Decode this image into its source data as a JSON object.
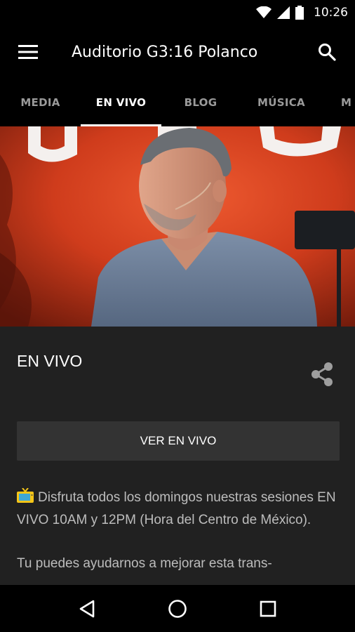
{
  "status_bar": {
    "time": "10:26",
    "icons": [
      "wifi-icon",
      "signal-icon",
      "battery-icon"
    ]
  },
  "app_bar": {
    "title": "Auditorio G3:16 Polanco",
    "menu_icon": "menu-icon",
    "search_icon": "search-icon"
  },
  "tabs": [
    {
      "label": "MEDIA",
      "active": false
    },
    {
      "label": "EN VIVO",
      "active": true
    },
    {
      "label": "BLOG",
      "active": false
    },
    {
      "label": "MÚSICA",
      "active": false
    },
    {
      "label": "M",
      "active": false
    }
  ],
  "content": {
    "title": "EN VIVO",
    "share_icon": "share-icon",
    "button_label": "VER EN VIVO",
    "paragraph_1": "Disfruta todos los domingos nuestras sesiones EN VIVO 10AM y 12PM (Hora del Centro de México).",
    "paragraph_2": "Tu puedes ayudarnos a mejorar esta trans-"
  },
  "nav_bar": {
    "icons": [
      "back-icon",
      "home-icon",
      "recents-icon"
    ]
  },
  "colors": {
    "background": "#000000",
    "content_bg": "#212121",
    "button_bg": "#333333",
    "hero_red": "#d63e1f"
  }
}
